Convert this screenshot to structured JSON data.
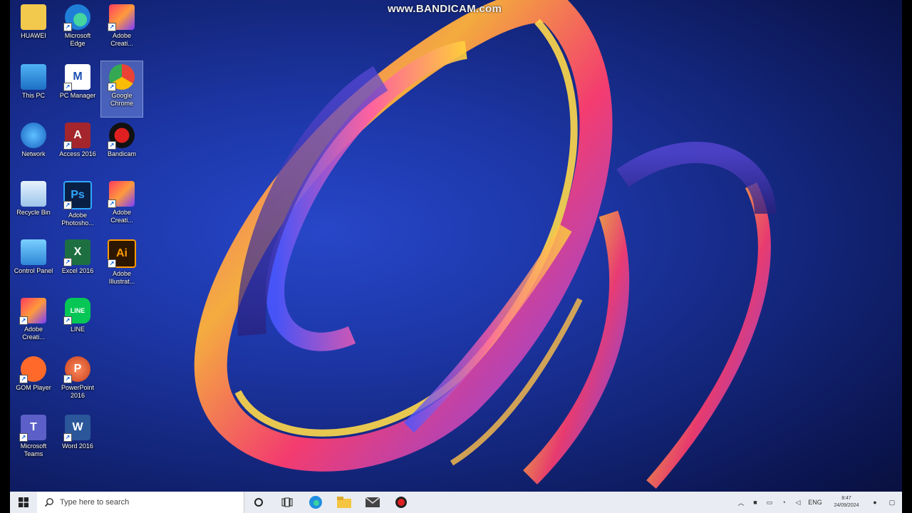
{
  "watermark": "www.BANDICAM.com",
  "desktop_icons": [
    {
      "label": "HUAWEI",
      "icon": "folder-user-icon"
    },
    {
      "label": "Microsoft Edge",
      "icon": "edge-icon"
    },
    {
      "label": "Adobe Creati...",
      "icon": "adobe-creative-cloud-icon"
    },
    {
      "label": "This PC",
      "icon": "computer-icon"
    },
    {
      "label": "PC Manager",
      "icon": "pc-manager-icon"
    },
    {
      "label": "Google Chrome",
      "icon": "chrome-icon"
    },
    {
      "label": "Network",
      "icon": "network-icon"
    },
    {
      "label": "Access 2016",
      "icon": "access-icon"
    },
    {
      "label": "Bandicam",
      "icon": "bandicam-icon"
    },
    {
      "label": "Recycle Bin",
      "icon": "recycle-bin-icon"
    },
    {
      "label": "Adobe Photosho...",
      "icon": "photoshop-icon"
    },
    {
      "label": "Adobe Creati...",
      "icon": "adobe-creative-cloud-icon"
    },
    {
      "label": "Control Panel",
      "icon": "control-panel-icon"
    },
    {
      "label": "Excel 2016",
      "icon": "excel-icon"
    },
    {
      "label": "Adobe Illustrat...",
      "icon": "illustrator-icon"
    },
    {
      "label": "Adobe Creati...",
      "icon": "adobe-creative-cloud-icon"
    },
    {
      "label": "LINE",
      "icon": "line-icon"
    },
    {
      "label": "GOM Player",
      "icon": "gom-player-icon"
    },
    {
      "label": "PowerPoint 2016",
      "icon": "powerpoint-icon"
    },
    {
      "label": "Microsoft Teams",
      "icon": "teams-icon"
    },
    {
      "label": "Word 2016",
      "icon": "word-icon"
    }
  ],
  "taskbar": {
    "search_placeholder": "Type here to search",
    "tray_lang": "ENG",
    "clock_time": "8:47",
    "clock_date": "24/09/2024"
  }
}
